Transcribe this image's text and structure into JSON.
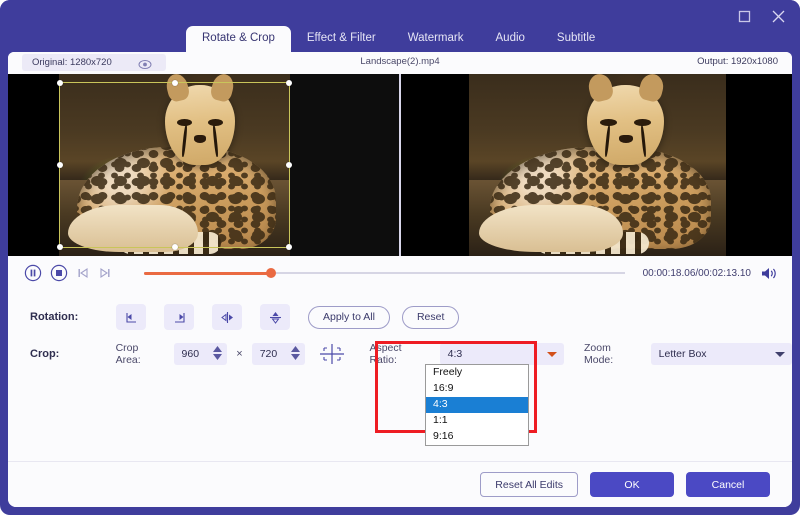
{
  "window": {
    "maximize_icon": "maximize-icon",
    "close_icon": "close-icon"
  },
  "tabs": [
    {
      "label": "Rotate & Crop",
      "active": true
    },
    {
      "label": "Effect & Filter",
      "active": false
    },
    {
      "label": "Watermark",
      "active": false
    },
    {
      "label": "Audio",
      "active": false
    },
    {
      "label": "Subtitle",
      "active": false
    }
  ],
  "info": {
    "original": "Original: 1280x720",
    "eye_icon": "eye-icon",
    "filename": "Landscape(2).mp4",
    "output": "Output: 1920x1080"
  },
  "player": {
    "pause_icon": "pause-icon",
    "stop_icon": "stop-icon",
    "prev_frame_icon": "previous-frame-icon",
    "next_frame_icon": "next-frame-icon",
    "time": "00:00:18.06/00:02:13.10",
    "volume_icon": "volume-icon",
    "progress_percent": 14
  },
  "rotation": {
    "label": "Rotation:",
    "buttons": [
      {
        "name": "rotate-left-icon"
      },
      {
        "name": "rotate-right-icon"
      },
      {
        "name": "flip-horizontal-icon"
      },
      {
        "name": "flip-vertical-icon"
      }
    ],
    "apply_to_all": "Apply to All",
    "reset": "Reset"
  },
  "crop": {
    "label": "Crop:",
    "area_label": "Crop Area:",
    "width": "960",
    "height": "720",
    "times": "×",
    "crop_tool_icon": "crop-tool-icon",
    "aspect_ratio_label": "Aspect Ratio:",
    "aspect_ratio_value": "4:3",
    "aspect_ratio_options": [
      {
        "label": "Freely",
        "selected": false
      },
      {
        "label": "16:9",
        "selected": false
      },
      {
        "label": "4:3",
        "selected": true
      },
      {
        "label": "1:1",
        "selected": false
      },
      {
        "label": "9:16",
        "selected": false
      }
    ],
    "zoom_mode_label": "Zoom Mode:",
    "zoom_mode_value": "Letter Box"
  },
  "footer": {
    "reset_all": "Reset All Edits",
    "ok": "OK",
    "cancel": "Cancel"
  },
  "colors": {
    "brand_purple": "#3f3d9c",
    "panel": "#fbfbfd",
    "accent_orange": "#ea6a42",
    "highlight_red": "#ee1c23",
    "select_blue": "#1a7fd4",
    "primary_button": "#4b49c4"
  }
}
